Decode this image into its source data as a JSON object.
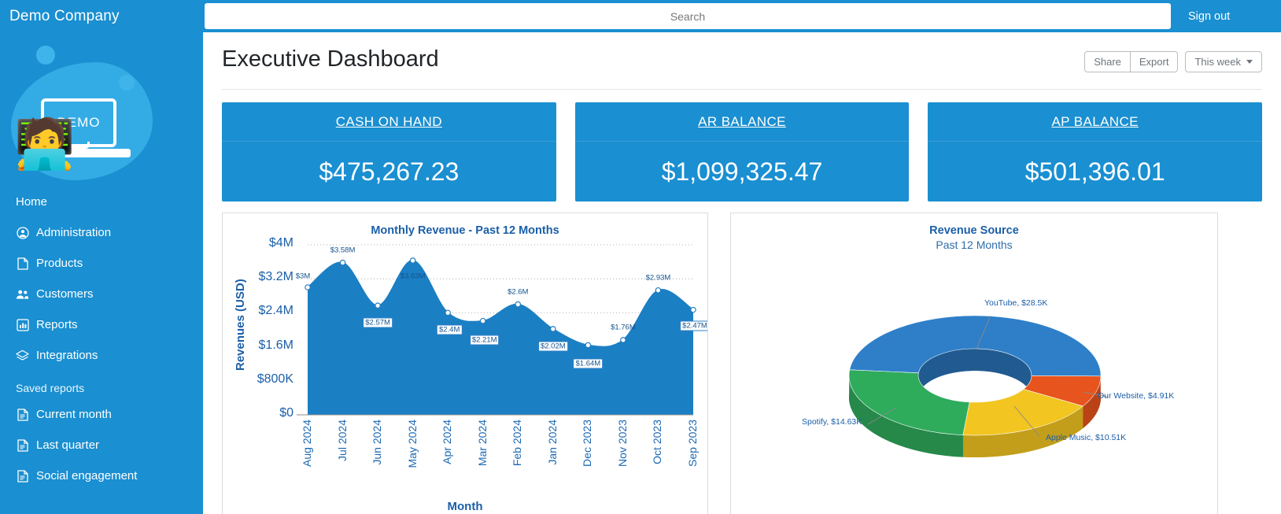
{
  "sidebar": {
    "brand": "Demo Company",
    "logo_text": "DEMO",
    "items": [
      {
        "label": "Home",
        "icon": "none"
      },
      {
        "label": "Administration",
        "icon": "user-circle-icon"
      },
      {
        "label": "Products",
        "icon": "file-icon"
      },
      {
        "label": "Customers",
        "icon": "people-icon"
      },
      {
        "label": "Reports",
        "icon": "bar-chart-icon"
      },
      {
        "label": "Integrations",
        "icon": "layers-icon"
      }
    ],
    "section_label": "Saved reports",
    "saved_reports": [
      {
        "label": "Current month",
        "icon": "report-file-icon"
      },
      {
        "label": "Last quarter",
        "icon": "report-file-icon"
      },
      {
        "label": "Social engagement",
        "icon": "report-file-icon"
      }
    ]
  },
  "topbar": {
    "search_placeholder": "Search",
    "search_value": "",
    "signout_label": "Sign out"
  },
  "header": {
    "title": "Executive Dashboard",
    "share_label": "Share",
    "export_label": "Export",
    "range_label": "This week"
  },
  "kpis": [
    {
      "label": "CASH ON HAND",
      "value": "$475,267.23"
    },
    {
      "label": "AR BALANCE",
      "value": "$1,099,325.47"
    },
    {
      "label": "AP BALANCE",
      "value": "$501,396.01"
    }
  ],
  "colors": {
    "brand_blue": "#1a8fd1",
    "chart_blue": "#1b7fc4",
    "axis_text": "#1b5fa8",
    "pie_youtube": "#2e7fc8",
    "pie_website": "#e8541d",
    "pie_apple": "#f2c521",
    "pie_spotify": "#2fab5c"
  },
  "chart_data": [
    {
      "type": "area",
      "title": "Monthly Revenue - Past 12 Months",
      "xlabel": "Month",
      "ylabel": "Revenues (USD)",
      "categories": [
        "Aug 2024",
        "Jul 2024",
        "Jun 2024",
        "May 2024",
        "Apr 2024",
        "Mar 2024",
        "Feb 2024",
        "Jan 2024",
        "Dec 2023",
        "Nov 2023",
        "Oct 2023",
        "Sep 2023"
      ],
      "values": [
        3000000,
        3580000,
        2570000,
        3630000,
        2400000,
        2210000,
        2600000,
        2020000,
        1640000,
        1760000,
        2930000,
        2470000
      ],
      "point_labels": [
        "$3M",
        "$3.58M",
        "$2.57M",
        "$3.63M",
        "$2.4M",
        "$2.21M",
        "$2.6M",
        "$2.02M",
        "$1.64M",
        "$1.76M",
        "$2.93M",
        "$2.47M"
      ],
      "ytick_labels": [
        "$0",
        "$800K",
        "$1.6M",
        "$2.4M",
        "$3.2M",
        "$4M"
      ],
      "ytick_values": [
        0,
        800000,
        1600000,
        2400000,
        3200000,
        4000000
      ],
      "ylim": [
        0,
        4000000
      ],
      "grid": true,
      "legend": "none"
    },
    {
      "type": "pie",
      "title": "Revenue Source",
      "subtitle": "Past 12 Months",
      "variant": "3d-donut",
      "categories": [
        "YouTube",
        "Our Website",
        "Apple Music",
        "Spotify"
      ],
      "values": [
        28500,
        4910,
        10510,
        14630
      ],
      "labels": [
        "YouTube, $28.5K",
        "Our Website, $4.91K",
        "Apple Music, $10.51K",
        "Spotify, $14.63K"
      ],
      "colors": [
        "#2e7fc8",
        "#e8541d",
        "#f2c521",
        "#2fab5c"
      ],
      "legend": "callout-labels"
    }
  ]
}
